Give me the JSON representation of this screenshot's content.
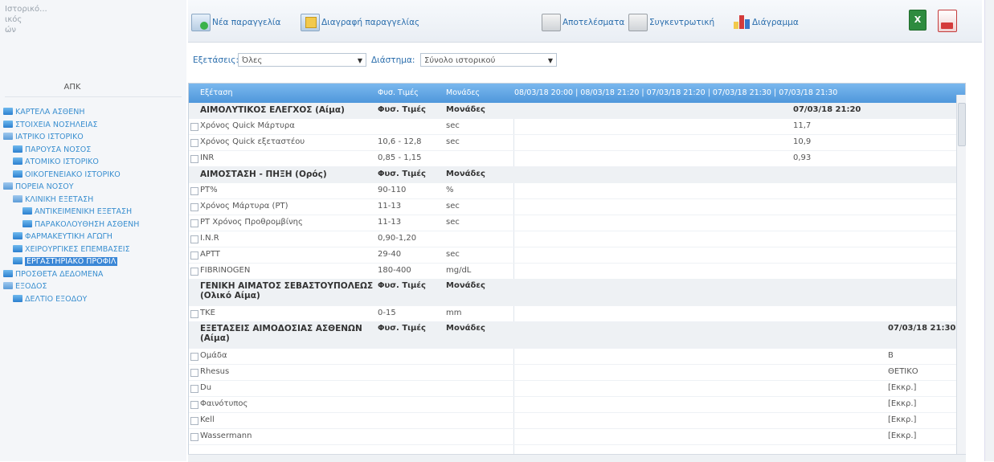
{
  "sidebar": {
    "patient_info": [
      "Ιστορικό...",
      "ικός",
      "ών"
    ],
    "heading": "ΑΠΚ",
    "items": [
      {
        "label": "ΚΑΡΤΕΛΑ ΑΣΘΕΝΗ",
        "indent": 0,
        "folder": false
      },
      {
        "label": "ΣΤΟΙΧΕΙΑ ΝΟΣΗΛΕΙΑΣ",
        "indent": 0,
        "folder": false
      },
      {
        "label": "ΙΑΤΡΙΚΟ ΙΣΤΟΡΙΚΟ",
        "indent": 0,
        "folder": true
      },
      {
        "label": "ΠΑΡΟΥΣΑ ΝΟΣΟΣ",
        "indent": 1,
        "folder": false
      },
      {
        "label": "ΑΤΟΜΙΚΟ ΙΣΤΟΡΙΚΟ",
        "indent": 1,
        "folder": false
      },
      {
        "label": "ΟΙΚΟΓΕΝΕΙΑΚΟ ΙΣΤΟΡΙΚΟ",
        "indent": 1,
        "folder": false
      },
      {
        "label": "ΠΟΡΕΙΑ ΝΟΣΟΥ",
        "indent": 0,
        "folder": true
      },
      {
        "label": "ΚΛΙΝΙΚΗ ΕΞΕΤΑΣΗ",
        "indent": 1,
        "folder": true
      },
      {
        "label": "ΑΝΤΙΚΕΙΜΕΝΙΚΗ ΕΞΕΤΑΣΗ",
        "indent": 2,
        "folder": false
      },
      {
        "label": "ΠΑΡΑΚΟΛΟΥΘΗΣΗ ΑΣΘΕΝΗ",
        "indent": 2,
        "folder": false
      },
      {
        "label": "ΦΑΡΜΑΚΕΥΤΙΚΗ ΑΓΩΓΗ",
        "indent": 1,
        "folder": false
      },
      {
        "label": "ΧΕΙΡΟΥΡΓΙΚΕΣ ΕΠΕΜΒΑΣΕΙΣ",
        "indent": 1,
        "folder": false
      },
      {
        "label": "ΕΡΓΑΣΤΗΡΙΑΚΟ ΠΡΟΦΙΛ",
        "indent": 1,
        "folder": false,
        "selected": true
      },
      {
        "label": "ΠΡΟΣΘΕΤΑ ΔΕΔΟΜΕΝΑ",
        "indent": 0,
        "folder": false
      },
      {
        "label": "ΕΞΟΔΟΣ",
        "indent": 0,
        "folder": true
      },
      {
        "label": "ΔΕΛΤΙΟ ΕΞΟΔΟΥ",
        "indent": 1,
        "folder": false
      }
    ]
  },
  "toolbar": {
    "new_order": "Νέα παραγγελία",
    "delete_order": "Διαγραφή παραγγελίας",
    "results": "Αποτελέσματα",
    "summary": "Συγκεντρωτική",
    "chart": "Διάγραμμα"
  },
  "filters": {
    "exam_label": "Εξετάσεις:",
    "exam_value": "Όλες",
    "period_label": "Διάστημα:",
    "period_value": "Σύνολο ιστορικού"
  },
  "grid": {
    "headers": {
      "name": "Εξέταση",
      "ref": "Φυσ. Τιμές",
      "unit": "Μονάδες",
      "dates": "08/03/18 20:00 | 08/03/18 21:20 | 07/03/18 21:20 | 07/03/18 21:30 | 07/03/18 21:30"
    },
    "rows": [
      {
        "type": "group",
        "name": "ΑΙΜΟΛΥΤΙΚΟΣ ΕΛΕΓΧΟΣ (Αίμα)",
        "ref": "Φυσ. Τιμές",
        "unit": "Μονάδες",
        "v1": "",
        "v2": "07/03/18 21:20"
      },
      {
        "type": "item",
        "name": "Χρόνος Quick Μάρτυρα",
        "ref": "",
        "unit": "sec",
        "v1": "",
        "v2": "11,7"
      },
      {
        "type": "item",
        "name": "Χρόνος Quick εξεταστέου",
        "ref": "10,6 - 12,8",
        "unit": "sec",
        "v1": "",
        "v2": "10,9"
      },
      {
        "type": "item",
        "name": "INR",
        "ref": "0,85 - 1,15",
        "unit": "",
        "v1": "",
        "v2": "0,93"
      },
      {
        "type": "group",
        "name": "ΑΙΜΟΣΤΑΣΗ - ΠΗΞΗ (Ορός)",
        "ref": "Φυσ. Τιμές",
        "unit": "Μονάδες",
        "v1": "",
        "v2": ""
      },
      {
        "type": "item",
        "name": "PT%",
        "ref": "90-110",
        "unit": "%",
        "v1": "",
        "v2": ""
      },
      {
        "type": "item",
        "name": "Χρόνος Μάρτυρα (PT)",
        "ref": "11-13",
        "unit": "sec",
        "v1": "",
        "v2": ""
      },
      {
        "type": "item",
        "name": "PT Χρόνος Προθρομβίνης",
        "ref": "11-13",
        "unit": "sec",
        "v1": "",
        "v2": ""
      },
      {
        "type": "item",
        "name": "I.N.R",
        "ref": "0,90-1,20",
        "unit": "",
        "v1": "",
        "v2": ""
      },
      {
        "type": "item",
        "name": "APTT",
        "ref": "29-40",
        "unit": "sec",
        "v1": "",
        "v2": ""
      },
      {
        "type": "item",
        "name": "FIBRINOGEN",
        "ref": "180-400",
        "unit": "mg/dL",
        "v1": "",
        "v2": ""
      },
      {
        "type": "group-tall",
        "name": "ΓΕΝΙΚΗ ΑΙΜΑΤΟΣ ΣΕΒΑΣΤΟΥΠΟΛΕΩΣ (Ολικό Αίμα)",
        "ref": "Φυσ. Τιμές",
        "unit": "Μονάδες",
        "v1": "",
        "v2": ""
      },
      {
        "type": "item",
        "name": "TKE",
        "ref": "0-15",
        "unit": "mm",
        "v1": "",
        "v2": ""
      },
      {
        "type": "group-tall",
        "name": "ΕΞΕΤΑΣΕΙΣ ΑΙΜΟΔΟΣΙΑΣ ΑΣΘΕΝΩΝ (Αίμα)",
        "ref": "Φυσ. Τιμές",
        "unit": "Μονάδες",
        "v1": "",
        "v2": "",
        "v3": "07/03/18 21:30"
      },
      {
        "type": "item",
        "name": "Ομάδα",
        "ref": "",
        "unit": "",
        "v1": "",
        "v2": "",
        "v3": "B"
      },
      {
        "type": "item",
        "name": "Rhesus",
        "ref": "",
        "unit": "",
        "v1": "",
        "v2": "",
        "v3": "ΘΕΤΙΚΟ"
      },
      {
        "type": "item",
        "name": "Du",
        "ref": "",
        "unit": "",
        "v1": "",
        "v2": "",
        "v3": "[Εκκρ.]"
      },
      {
        "type": "item",
        "name": "Φαινότυπος",
        "ref": "",
        "unit": "",
        "v1": "",
        "v2": "",
        "v3": "[Εκκρ.]"
      },
      {
        "type": "item",
        "name": "Kell",
        "ref": "",
        "unit": "",
        "v1": "",
        "v2": "",
        "v3": "[Εκκρ.]"
      },
      {
        "type": "item",
        "name": "Wassermann",
        "ref": "",
        "unit": "",
        "v1": "",
        "v2": "",
        "v3": "[Εκκρ.]"
      }
    ]
  },
  "colors": {
    "accent": "#3b87d6",
    "header_blue": "#4f97db",
    "link": "#2c6fad"
  }
}
